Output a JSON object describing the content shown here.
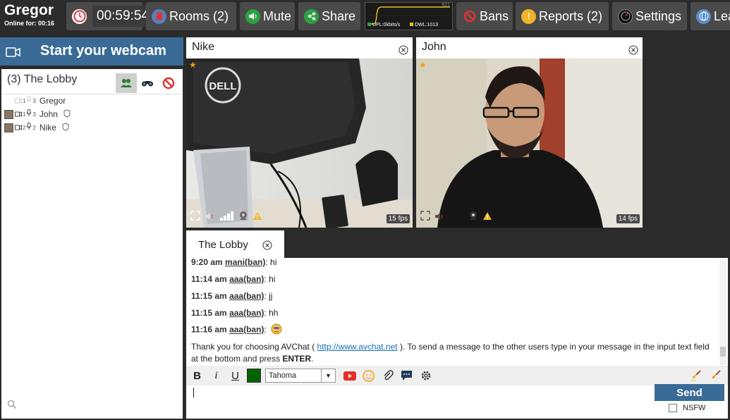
{
  "user": {
    "name": "Gregor",
    "online_for": "Online for: 00:16"
  },
  "topbar": {
    "timer": "00:59:54",
    "rooms_label": "Rooms (2)",
    "mute_label": "Mute",
    "share_label": "Share",
    "bandwidth": {
      "peak": "921",
      "upload": "UPL:0kbits/s",
      "download": "DWL:1013"
    },
    "bans_label": "Bans",
    "reports_label": "Reports (2)",
    "settings_label": "Settings",
    "leave_label": "Lea"
  },
  "webcam": {
    "label": "Start your webcam"
  },
  "room": {
    "title": "(3) The Lobby",
    "users": [
      {
        "name": "Gregor",
        "cam": "1",
        "mic": "3",
        "avatar": false
      },
      {
        "name": "John",
        "cam": "1",
        "mic": "3",
        "avatar": true
      },
      {
        "name": "Nike",
        "cam": "2",
        "mic": "2",
        "avatar": true
      }
    ]
  },
  "videos": [
    {
      "name": "Nike",
      "fps": "15 fps"
    },
    {
      "name": "John",
      "fps": "14 fps"
    }
  ],
  "chat": {
    "tab_label": "The Lobby",
    "messages": [
      {
        "time": "9:20 am",
        "user": "mani(ban)",
        "text": ": hi"
      },
      {
        "time": "11:14 am",
        "user": "aaa(ban)",
        "text": ": hi"
      },
      {
        "time": "11:15 am",
        "user": "aaa(ban)",
        "text": ": jj"
      },
      {
        "time": "11:15 am",
        "user": "aaa(ban)",
        "text": ": hh"
      },
      {
        "time": "11:16 am",
        "user": "aaa(ban)",
        "text": ":"
      }
    ],
    "welcome": {
      "pre": "Thank you for choosing AVChat ( ",
      "link": "http://www.avchat.net",
      "mid": " ). To send a message to the other users type in your message in the input text field at the bottom and press ",
      "key": "ENTER",
      "post": "."
    },
    "toolbar": {
      "bold": "B",
      "italic": "i",
      "underline": "U",
      "font": "Tahoma",
      "text_color": "#006400"
    },
    "send_label": "Send",
    "nsfw_label": "NSFW"
  }
}
